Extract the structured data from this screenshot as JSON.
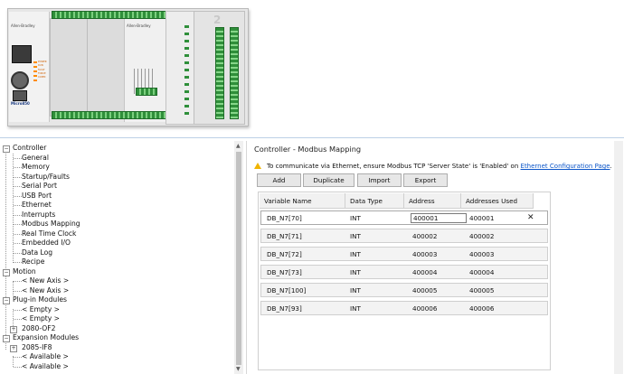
{
  "device": {
    "brand": "Allen-Bradley",
    "model": "Micro850",
    "led_labels": [
      "POWER",
      "RUN",
      "FAULT",
      "FORCE",
      "COMM"
    ],
    "slot_label": "2"
  },
  "tree": [
    {
      "label": "Controller",
      "expander": "−"
    },
    {
      "label": "General"
    },
    {
      "label": "Memory"
    },
    {
      "label": "Startup/Faults"
    },
    {
      "label": "Serial Port"
    },
    {
      "label": "USB Port"
    },
    {
      "label": "Ethernet"
    },
    {
      "label": "Interrupts"
    },
    {
      "label": "Modbus Mapping"
    },
    {
      "label": "Real Time Clock"
    },
    {
      "label": "Embedded I/O"
    },
    {
      "label": "Data Log"
    },
    {
      "label": "Recipe"
    },
    {
      "label": "Motion",
      "expander": "−"
    },
    {
      "label": "< New Axis >"
    },
    {
      "label": "< New Axis >"
    },
    {
      "label": "Plug-in Modules",
      "expander": "−"
    },
    {
      "label": "< Empty >"
    },
    {
      "label": "< Empty >"
    },
    {
      "label": "2080-OF2",
      "expander": "+"
    },
    {
      "label": "Expansion Modules",
      "expander": "−"
    },
    {
      "label": "2085-IF8",
      "expander": "+"
    },
    {
      "label": "< Available >"
    },
    {
      "label": "< Available >"
    }
  ],
  "page": {
    "title": "Controller - Modbus Mapping",
    "info_text": "To communicate via Ethernet, ensure Modbus TCP 'Server State' is 'Enabled' on ",
    "info_link": "Ethernet Configuration Page",
    "info_end": "."
  },
  "toolbar": {
    "add_label": "Add",
    "duplicate_label": "Duplicate",
    "import_label": "Import",
    "export_label": "Export"
  },
  "table": {
    "columns": [
      "Variable Name",
      "Data Type",
      "Address",
      "Addresses Used"
    ],
    "rows": [
      {
        "variable": "DB_N7[70]",
        "type": "INT",
        "address": "400001",
        "used": "400001"
      },
      {
        "variable": "DB_N7[71]",
        "type": "INT",
        "address": "400002",
        "used": "400002"
      },
      {
        "variable": "DB_N7[72]",
        "type": "INT",
        "address": "400003",
        "used": "400003"
      },
      {
        "variable": "DB_N7[73]",
        "type": "INT",
        "address": "400004",
        "used": "400004"
      },
      {
        "variable": "DB_N7[100]",
        "type": "INT",
        "address": "400005",
        "used": "400005"
      },
      {
        "variable": "DB_N7[93]",
        "type": "INT",
        "address": "400006",
        "used": "400006"
      }
    ],
    "delete_glyph": "✕"
  },
  "colors": {
    "accent_link": "#0b55c8",
    "warning": "#f0b400",
    "terminal_green": "#2f8f3a"
  }
}
